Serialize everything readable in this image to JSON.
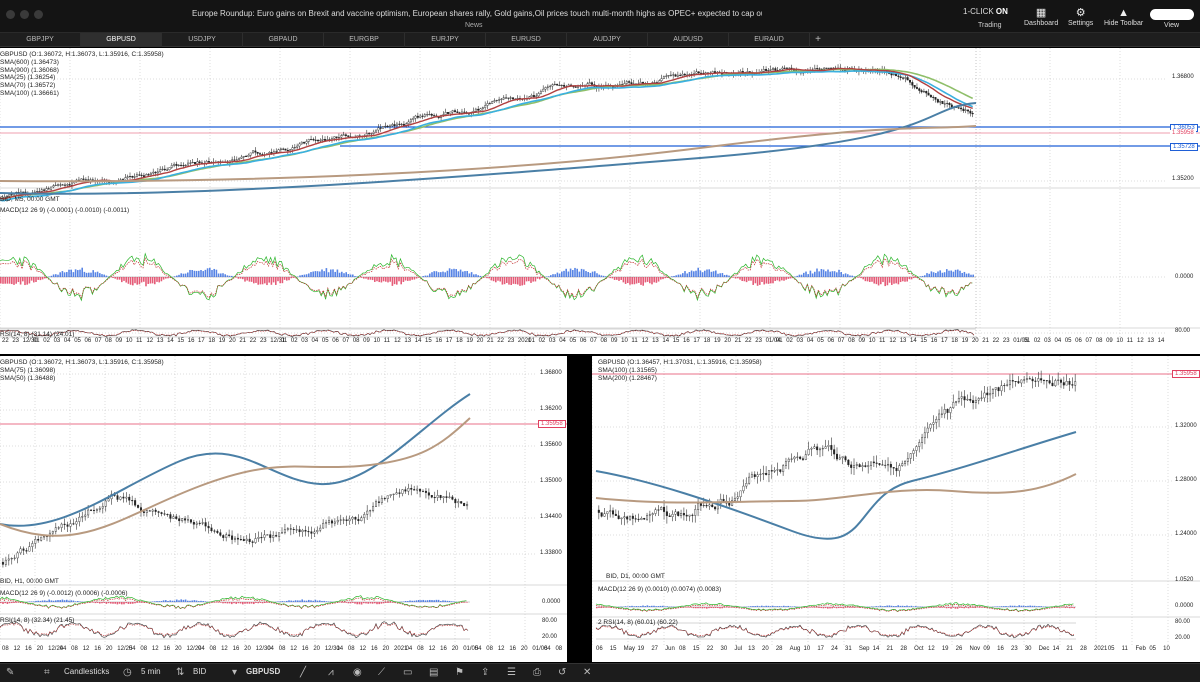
{
  "news": {
    "ticker": "Europe Roundup: Euro gains  on Brexit and vaccine optimism, European shares rally, Gold gains,Oil prices touch multi-month highs as OPEC+ expected to cap output-Janu:",
    "label": "News"
  },
  "toolbar": {
    "one_click_prefix": "1-CLICK",
    "one_click_state": "ON",
    "trading": "Trading",
    "dashboard": "Dashboard",
    "settings": "Settings",
    "hide_toolbar": "Hide Toolbar",
    "view": "View"
  },
  "tabs": [
    "GBPJPY",
    "GBPUSD",
    "USDJPY",
    "GBPAUD",
    "EURGBP",
    "EURJPY",
    "EURUSD",
    "AUDJPY",
    "AUDUSD",
    "EURAUD",
    "+"
  ],
  "active_tab": 1,
  "top_chart": {
    "ohlc": "GBPUSD (O:1.36072, H:1.36073, L:1.35916, C:1.35958)",
    "indicators": [
      "SMA(600) (1.36473)",
      "SMA(900) (1.36068)",
      "SMA(25) (1.36254)",
      "SMA(70) (1.36572)",
      "SMA(100) (1.36661)"
    ],
    "bid": "BID, M5, 00:00 GMT",
    "macd": "MACD(12 26 9) (-0.0001) (-0.0010) (-0.0011)",
    "rsi": "RSI(14, 8) (31.14) (24.01)",
    "price_labels": [
      "1.36800",
      "1.35200",
      "0.0000",
      "80.00"
    ],
    "price_tags": [
      "1.36053",
      "1.35958",
      "1.35728"
    ],
    "x_ticks": [
      "22",
      "23",
      "12/30",
      "01",
      "02",
      "03",
      "04",
      "05",
      "06",
      "07",
      "08",
      "09",
      "10",
      "11",
      "12",
      "13",
      "14",
      "15",
      "16",
      "17",
      "18",
      "19",
      "20",
      "21",
      "22",
      "23",
      "12/31",
      "01",
      "02",
      "03",
      "04",
      "05",
      "06",
      "07",
      "08",
      "09",
      "10",
      "11",
      "12",
      "13",
      "14",
      "15",
      "16",
      "17",
      "18",
      "19",
      "20",
      "21",
      "22",
      "23",
      "2021",
      "01",
      "02",
      "03",
      "04",
      "05",
      "06",
      "07",
      "08",
      "09",
      "10",
      "11",
      "12",
      "13",
      "14",
      "15",
      "16",
      "17",
      "18",
      "19",
      "20",
      "21",
      "22",
      "23",
      "01/04",
      "01",
      "02",
      "03",
      "04",
      "05",
      "06",
      "07",
      "08",
      "09",
      "10",
      "11",
      "12",
      "13",
      "14",
      "15",
      "16",
      "17",
      "18",
      "19",
      "20",
      "21",
      "22",
      "23",
      "01/05",
      "01",
      "02",
      "03",
      "04",
      "05",
      "06",
      "07",
      "08",
      "09",
      "10",
      "11",
      "12",
      "13",
      "14"
    ]
  },
  "left_chart": {
    "ohlc": "GBPUSD (O:1.36072, H:1.36073, L:1.35916, C:1.35958)",
    "indicators": [
      "SMA(75) (1.36098)",
      "SMA(50) (1.36488)"
    ],
    "bid": "BID, H1, 00:00 GMT",
    "macd": "MACD(12 26 9) (-0.0012) (0.0006) (-0.0006)",
    "rsi": "RSI(14, 8) (32.34) (21.45)",
    "price_labels": [
      "1.36800",
      "1.36200",
      "1.35600",
      "1.35000",
      "1.34400",
      "1.33800",
      "0.0000",
      "80.00",
      "20.00"
    ],
    "price_tag": "1.35958",
    "x_ticks": [
      "08",
      "12",
      "16",
      "20",
      "12/24",
      "04",
      "08",
      "12",
      "16",
      "20",
      "12/25",
      "04",
      "08",
      "12",
      "16",
      "20",
      "12/29",
      "04",
      "08",
      "12",
      "16",
      "20",
      "12/30",
      "04",
      "08",
      "12",
      "16",
      "20",
      "12/31",
      "04",
      "08",
      "12",
      "16",
      "20",
      "2021",
      "04",
      "08",
      "12",
      "16",
      "20",
      "01/05",
      "04",
      "08",
      "12",
      "16",
      "20",
      "01/06",
      "04",
      "08"
    ]
  },
  "right_chart": {
    "ohlc": "GBPUSD (O:1.36457, H:1.37031, L:1.35916, C:1.35958)",
    "indicators": [
      "SMA(100) (1.31565)",
      "SMA(200) (1.28467)"
    ],
    "bid": "BID, D1, 00:00 GMT",
    "macd": "MACD(12 26 9) (0.0010) (0.0074) (0.0083)",
    "rsi": "2 RSI(14, 8) (60.01) (60.22)",
    "price_labels": [
      "1.32000",
      "1.28000",
      "1.24000",
      "1.0520",
      "0.0000",
      "80.00",
      "20.00"
    ],
    "price_tag": "1.35958",
    "x_ticks": [
      "06",
      "15",
      "May",
      "19",
      "27",
      "Jun",
      "08",
      "15",
      "22",
      "30",
      "Jul",
      "13",
      "20",
      "28",
      "Aug",
      "10",
      "17",
      "24",
      "31",
      "Sep",
      "14",
      "21",
      "28",
      "Oct",
      "12",
      "19",
      "26",
      "Nov",
      "09",
      "16",
      "23",
      "30",
      "Dec",
      "14",
      "21",
      "28",
      "2021",
      "05",
      "11",
      "Feb",
      "05",
      "10"
    ]
  },
  "bottom_toolbar": {
    "chart_type": "Candlesticks",
    "timeframe": "5 min",
    "price_type": "BID",
    "symbol": "GBPUSD"
  },
  "colors": {
    "sma_blue": "#4a7fa6",
    "sma_tan": "#b89a80",
    "sma_red": "#b04040",
    "sma_cyan": "#3ab0e0",
    "sma_green": "#8fbf6a",
    "hline_blue": "#1f5fd6",
    "hline_red": "#e04060",
    "macd_pos": "#3a6fe0",
    "macd_neg": "#e04060"
  }
}
